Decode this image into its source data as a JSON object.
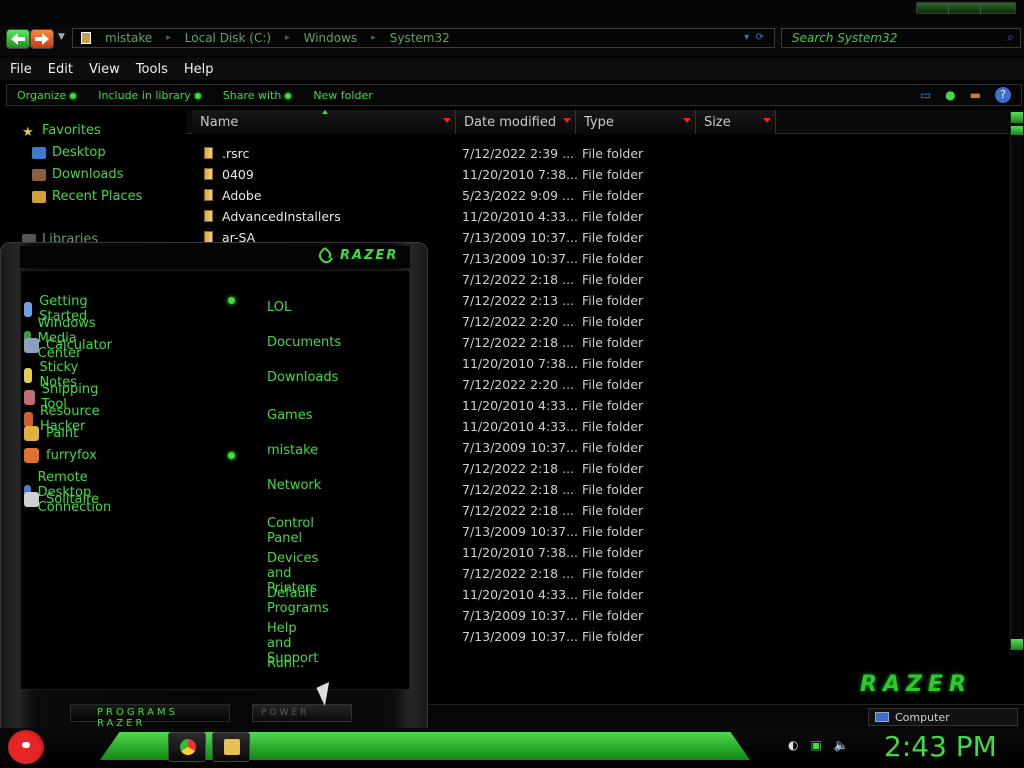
{
  "address": {
    "crumbs": [
      "mistake",
      "Local Disk (C:)",
      "Windows",
      "System32"
    ],
    "search_placeholder": "Search System32"
  },
  "menubar": [
    "File",
    "Edit",
    "View",
    "Tools",
    "Help"
  ],
  "commands": [
    "Organize",
    "Include in library",
    "Share with",
    "New folder"
  ],
  "nav": {
    "favorites": "Favorites",
    "items": [
      "Desktop",
      "Downloads",
      "Recent Places"
    ],
    "libraries": "Libraries"
  },
  "columns": [
    "Name",
    "Date modified",
    "Type",
    "Size"
  ],
  "files": [
    {
      "name": ".rsrc",
      "date": "7/12/2022 2:39 ...",
      "type": "File folder"
    },
    {
      "name": "0409",
      "date": "11/20/2010 7:38...",
      "type": "File folder"
    },
    {
      "name": "Adobe",
      "date": "5/23/2022 9:09 ...",
      "type": "File folder"
    },
    {
      "name": "AdvancedInstallers",
      "date": "11/20/2010 4:33...",
      "type": "File folder"
    },
    {
      "name": "ar-SA",
      "date": "7/13/2009 10:37...",
      "type": "File folder"
    },
    {
      "name": "",
      "date": "7/13/2009 10:37...",
      "type": "File folder"
    },
    {
      "name": "",
      "date": "7/12/2022 2:18 ...",
      "type": "File folder"
    },
    {
      "name": "",
      "date": "7/12/2022 2:13 ...",
      "type": "File folder"
    },
    {
      "name": "",
      "date": "7/12/2022 2:20 ...",
      "type": "File folder"
    },
    {
      "name": "",
      "date": "7/12/2022 2:18 ...",
      "type": "File folder"
    },
    {
      "name": "",
      "date": "11/20/2010 7:38...",
      "type": "File folder"
    },
    {
      "name": "",
      "date": "7/12/2022 2:20 ...",
      "type": "File folder"
    },
    {
      "name": "",
      "date": "11/20/2010 4:33...",
      "type": "File folder"
    },
    {
      "name": "",
      "date": "11/20/2010 4:33...",
      "type": "File folder"
    },
    {
      "name": "",
      "date": "7/13/2009 10:37...",
      "type": "File folder"
    },
    {
      "name": "",
      "date": "7/12/2022 2:18 ...",
      "type": "File folder"
    },
    {
      "name": "",
      "date": "7/12/2022 2:18 ...",
      "type": "File folder"
    },
    {
      "name": "",
      "date": "7/12/2022 2:18 ...",
      "type": "File folder"
    },
    {
      "name": "",
      "date": "7/13/2009 10:37...",
      "type": "File folder"
    },
    {
      "name": "",
      "date": "11/20/2010 7:38...",
      "type": "File folder"
    },
    {
      "name": "",
      "date": "7/12/2022 2:18 ...",
      "type": "File folder"
    },
    {
      "name": "",
      "date": "11/20/2010 4:33...",
      "type": "File folder"
    },
    {
      "name": "",
      "date": "7/13/2009 10:37...",
      "type": "File folder"
    },
    {
      "name": "",
      "date": "7/13/2009 10:37...",
      "type": "File folder"
    }
  ],
  "startmenu": {
    "brand": "RAZER",
    "programs": [
      "Getting Started",
      "Windows Media Center",
      "Calculator",
      "Sticky Notes",
      "Snipping Tool",
      "Resource Hacker",
      "Paint",
      "furryfox",
      "Remote Desktop Connection",
      "Solitaire"
    ],
    "places": [
      "LOL",
      "Documents",
      "Downloads",
      "Games",
      "mistake",
      "Network",
      "Control Panel",
      "Devices and Printers",
      "Default Programs",
      "Help and Support",
      "Run..."
    ],
    "programs_label": "PROGRAMS RAZER",
    "power_label": "POWER"
  },
  "statusbar": {
    "location": "Computer"
  },
  "brand_logo": "RAZER",
  "clock": "2:43 PM",
  "colors": {
    "accent": "#3fdc3f",
    "background": "#000000",
    "sort_arrow": "#e0282a"
  }
}
